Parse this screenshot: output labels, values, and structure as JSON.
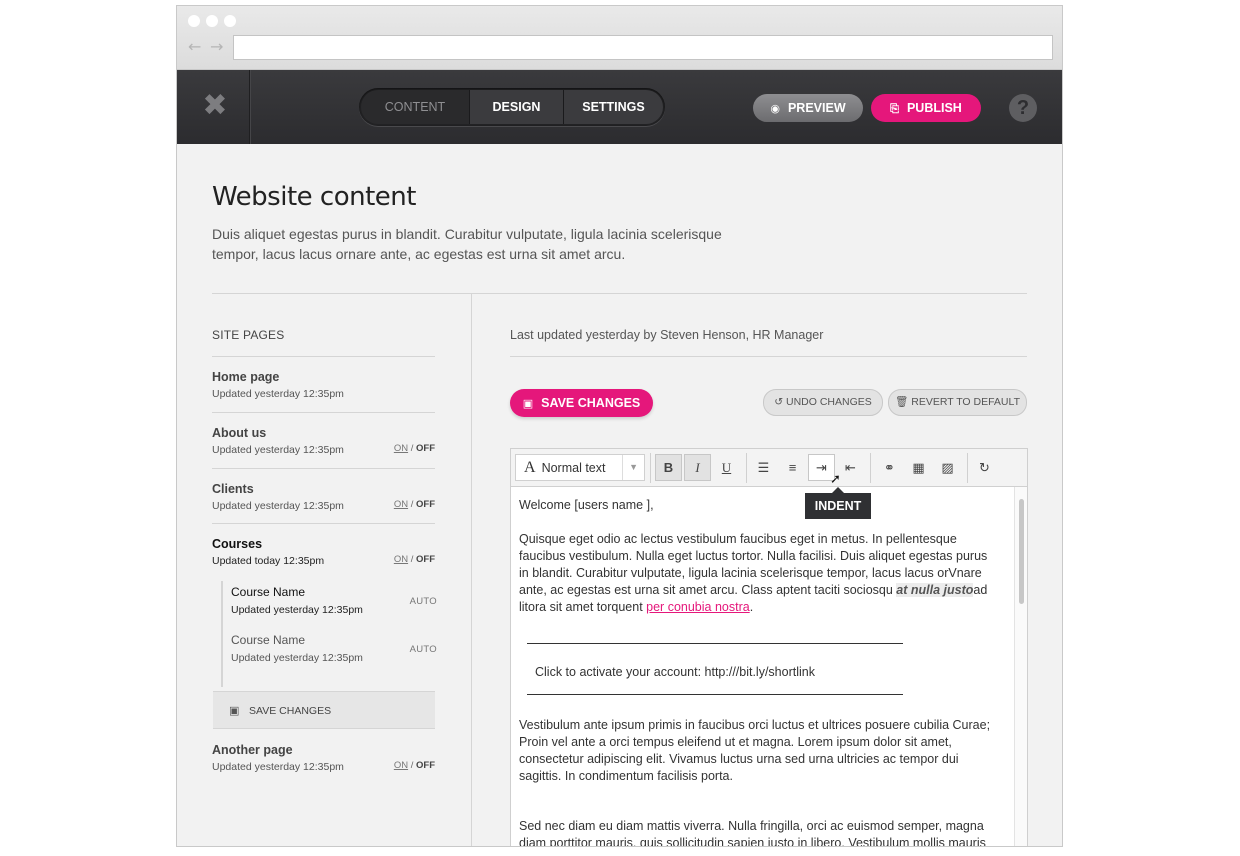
{
  "app": {
    "close_glyph": "✖",
    "tabs": [
      {
        "label": "CONTENT",
        "active": true
      },
      {
        "label": "DESIGN",
        "active": false
      },
      {
        "label": "SETTINGS",
        "active": false
      }
    ],
    "preview_label": "PREVIEW",
    "publish_label": "PUBLISH",
    "help_glyph": "?",
    "accent_color": "#e5177b"
  },
  "header": {
    "title": "Website content",
    "description": "Duis aliquet egestas purus in blandit. Curabitur vulputate, ligula lacinia scelerisque tempor, lacus lacus ornare ante, ac egestas est urna sit amet arcu."
  },
  "sidebar": {
    "title": "SITE PAGES",
    "on_label": "ON",
    "off_label": "OFF",
    "pages": [
      {
        "name": "Home page",
        "updated": "Updated yesterday 12:35pm",
        "toggle": false
      },
      {
        "name": "About us",
        "updated": "Updated yesterday 12:35pm",
        "toggle": true
      },
      {
        "name": "Clients",
        "updated": "Updated yesterday 12:35pm",
        "toggle": true
      },
      {
        "name": "Courses",
        "updated": "Updated today 12:35pm",
        "toggle": true,
        "expanded": true
      },
      {
        "name": "Another page",
        "updated": "Updated yesterday 12:35pm",
        "toggle": true
      }
    ],
    "sub_pages": [
      {
        "name": "Course Name",
        "updated": "Updated yesterday 12:35pm",
        "status": "AUTO"
      },
      {
        "name": "Course Name",
        "updated": "Updated yesterday 12:35pm",
        "status": "AUTO"
      }
    ],
    "save_label": "SAVE CHANGES"
  },
  "editor": {
    "last_updated": "Last updated yesterday by Steven Henson, HR Manager",
    "save_label": "SAVE CHANGES",
    "undo_label": "UNDO CHANGES",
    "revert_label": "REVERT TO DEFAULT",
    "format_value": "Normal text",
    "tooltip": "INDENT",
    "greeting": "Welcome [users name ],",
    "para1_start": "Quisque eget odio ac lectus vestibulum faucibus eget in metus. In pellentesque faucibus vestibulum. Nulla eget luctus tortor. Nulla facilisi. Duis aliquet egestas purus in blandit. Curabitur vulputate, ligula lacinia scelerisque tempor, lacus lacus orVnare ante, ac egestas est urna sit amet arcu. Class aptent taciti sociosqu ",
    "para1_emph": "at nulla justo",
    "para1_mid": "ad litora sit amet torquent ",
    "para1_link": "per conubia nostra",
    "para1_end": ".",
    "callout": "Click to activate your account: http:///bit.ly/shortlink",
    "para2": "Vestibulum ante ipsum primis in faucibus orci luctus et ultrices posuere cubilia Curae; Proin vel ante a orci tempus eleifend ut et magna. Lorem ipsum dolor sit amet, consectetur adipiscing elit. Vivamus luctus urna sed urna ultricies ac tempor dui sagittis. In condimentum facilisis porta.",
    "para3": "Sed nec diam eu diam mattis viverra. Nulla fringilla, orci ac euismod semper, magna diam porttitor mauris, quis sollicitudin sapien justo in libero. Vestibulum mollis mauris"
  }
}
